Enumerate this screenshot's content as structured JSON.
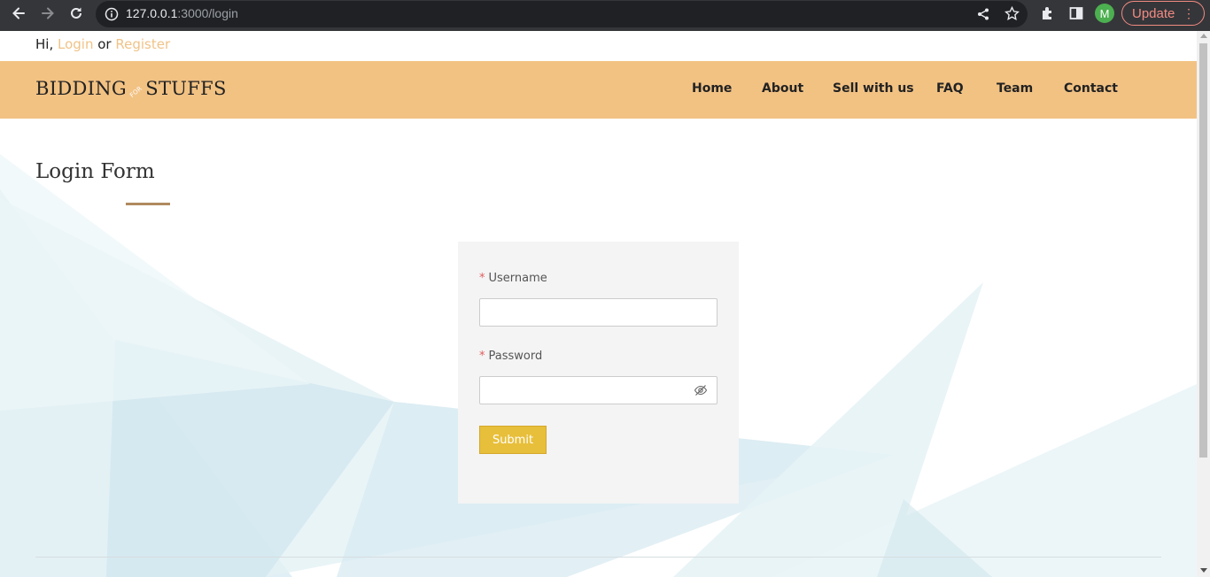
{
  "browser": {
    "url_host": "127.0.0.1",
    "url_rest": ":3000/login",
    "avatar_letter": "M",
    "update_label": "Update"
  },
  "topbar": {
    "greeting": "Hi,",
    "login": "Login",
    "or": "or",
    "register": "Register"
  },
  "header": {
    "brand_left": "BIDDING",
    "brand_for": "FOR",
    "brand_right": "STUFFS",
    "nav": {
      "home": "Home",
      "about": "About",
      "sell": "Sell with us",
      "faq": "FAQ",
      "team": "Team",
      "contact": "Contact"
    }
  },
  "page": {
    "title": "Login Form"
  },
  "form": {
    "required_mark": "*",
    "username_label": "Username",
    "username_value": "",
    "password_label": "Password",
    "password_value": "",
    "submit_label": "Submit"
  },
  "colors": {
    "header_bg": "#f2c283",
    "link": "#f0c387",
    "submit_bg": "#e8bf3a",
    "title_rule": "#b08a5f",
    "required": "#e25c5c"
  },
  "icons": [
    "back-arrow-icon",
    "forward-arrow-icon",
    "reload-icon",
    "info-icon",
    "share-icon",
    "star-icon",
    "extensions-icon",
    "side-panel-icon",
    "eye-off-icon"
  ]
}
